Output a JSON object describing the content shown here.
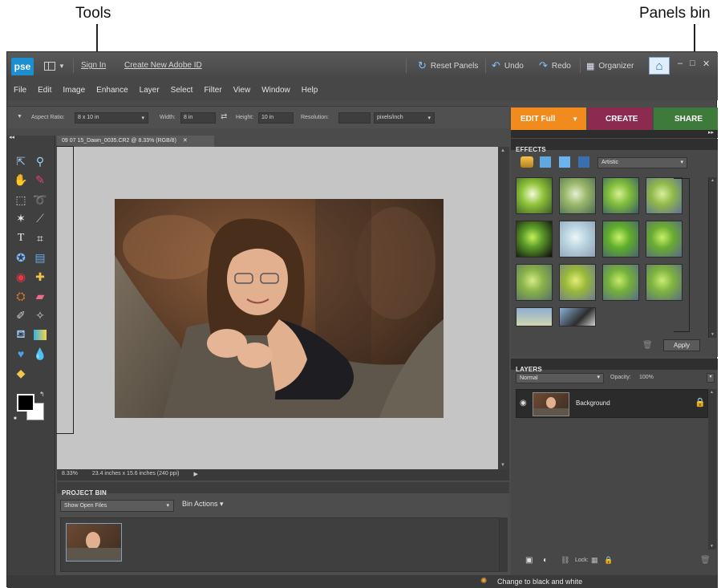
{
  "callouts": {
    "tools": "Tools",
    "panels_bin": "Panels bin"
  },
  "titlebar": {
    "logo": "pse",
    "sign_in": "Sign In",
    "create_id": "Create New Adobe ID",
    "reset_panels": "Reset Panels",
    "undo": "Undo",
    "redo": "Redo",
    "organizer": "Organizer"
  },
  "menu": [
    "File",
    "Edit",
    "Image",
    "Enhance",
    "Layer",
    "Select",
    "Filter",
    "View",
    "Window",
    "Help"
  ],
  "options": {
    "aspect_ratio_label": "Aspect Ratio:",
    "aspect_ratio_value": "8 x 10 in",
    "width_label": "Width:",
    "width_value": "8 in",
    "height_label": "Height:",
    "height_value": "10 in",
    "resolution_label": "Resolution:",
    "resolution_unit": "pixels/inch"
  },
  "modes": {
    "edit": "EDIT Full",
    "create": "CREATE",
    "share": "SHARE"
  },
  "document": {
    "tab_title": "09 07 15_Dawn_0035.CR2 @ 8.33% (RGB/8)",
    "zoom": "8.33%",
    "doc_size": "23.4 inches x 15.6 inches (240 ppi)"
  },
  "project_bin": {
    "title": "PROJECT BIN",
    "show_open_files": "Show Open Files",
    "bin_actions": "Bin Actions"
  },
  "effects": {
    "title": "EFFECTS",
    "category": "Artistic",
    "apply": "Apply"
  },
  "layers": {
    "title": "LAYERS",
    "blend_mode": "Normal",
    "opacity_label": "Opacity:",
    "opacity_value": "100%",
    "layer_name": "Background",
    "lock_label": "Lock:"
  },
  "status": {
    "hint": "Change to black and white"
  },
  "colors": {
    "edit_tab": "#f28b1e",
    "create_tab": "#8c2a4f",
    "share_tab": "#3e7a3a",
    "logo_blue": "#1c8fd1"
  }
}
